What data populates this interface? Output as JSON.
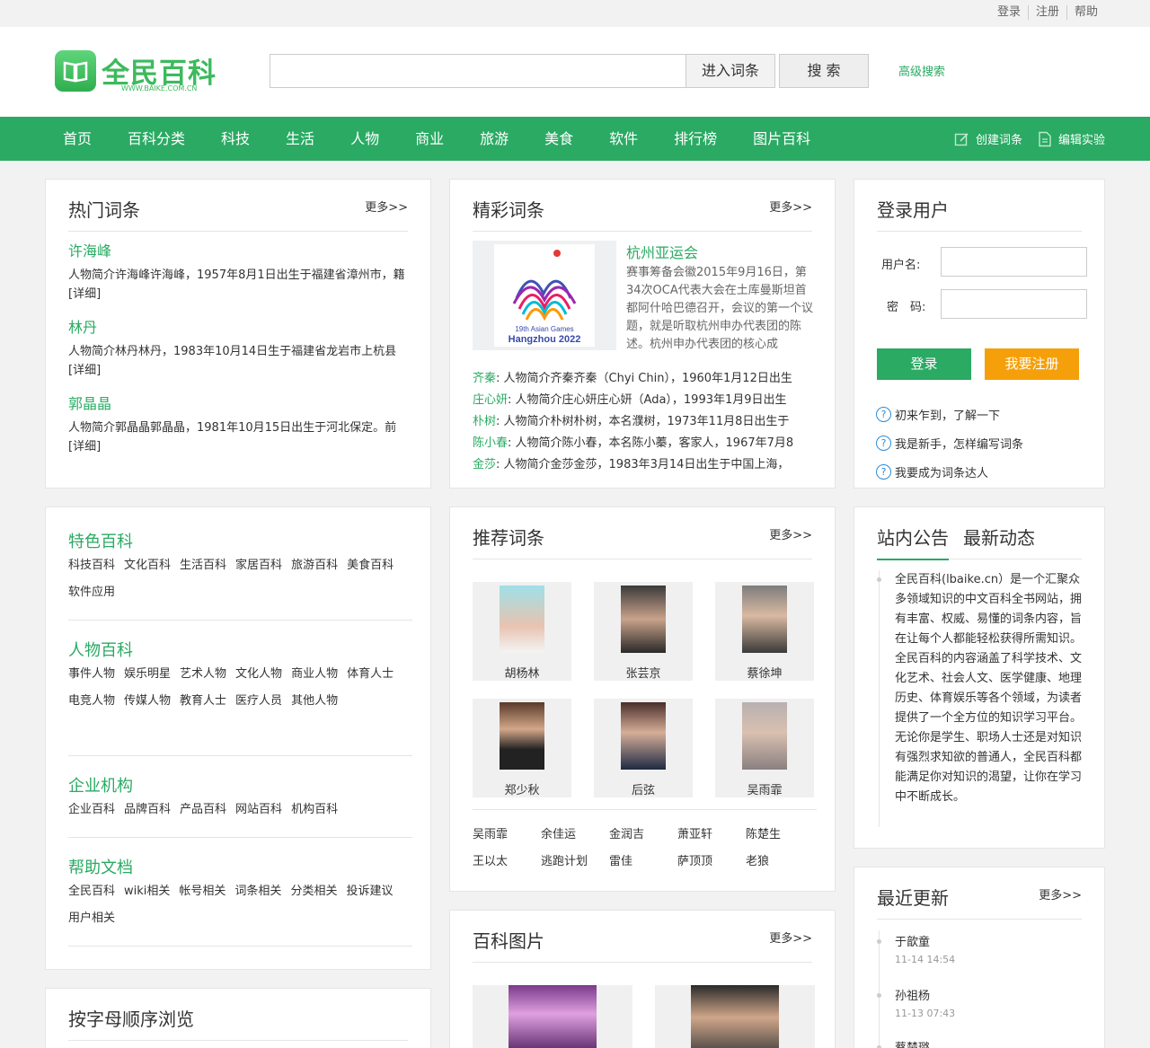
{
  "topbar": {
    "links": [
      "登录",
      "注册",
      "帮助"
    ]
  },
  "header": {
    "logo_text": "全民百科",
    "logo_sub": "WWW.BAIKE.COM.CN",
    "search_placeholder": "",
    "enter_button": "进入词条",
    "search_button": "搜 索",
    "advanced": "高级搜索"
  },
  "nav": {
    "items": [
      "首页",
      "百科分类",
      "科技",
      "生活",
      "人物",
      "商业",
      "旅游",
      "美食",
      "软件",
      "排行榜",
      "图片百科"
    ],
    "create": "创建词条",
    "edit": "编辑实验"
  },
  "hot": {
    "title": "热门词条",
    "more": "更多>>",
    "items": [
      {
        "name": "许海峰",
        "desc": "人物简介许海峰许海峰，1957年8月1日出生于福建省漳州市，籍[详细]"
      },
      {
        "name": "林丹",
        "desc": "人物简介林丹林丹，1983年10月14日生于福建省龙岩市上杭县[详细]"
      },
      {
        "name": "郭晶晶",
        "desc": "人物简介郭晶晶郭晶晶，1981年10月15日出生于河北保定。前[详细]"
      }
    ]
  },
  "featured": {
    "title": "精彩词条",
    "more": "更多>>",
    "main_title": "杭州亚运会",
    "main_desc": "赛事筹备会徽2015年9月16日，第34次OCA代表大会在土库曼斯坦首都阿什哈巴德召开，会议的第一个议题，就是听取杭州申办代表团的陈述。杭州申办代表团的核心成",
    "img_text1": "19th Asian Games",
    "img_text2": "Hangzhou 2022",
    "list": [
      {
        "name": "齐秦",
        "text": ": 人物简介齐秦齐秦（Chyi Chin），1960年1月12日出生"
      },
      {
        "name": "庄心妍",
        "text": ": 人物简介庄心妍庄心妍（Ada），1993年1月9日出生"
      },
      {
        "name": "朴树",
        "text": ": 人物简介朴树朴树，本名濮树，1973年11月8日出生于"
      },
      {
        "name": "陈小春",
        "text": ": 人物简介陈小春，本名陈小蓁，客家人，1967年7月8"
      },
      {
        "name": "金莎",
        "text": ": 人物简介金莎金莎，1983年3月14日出生于中国上海，"
      }
    ]
  },
  "login": {
    "title": "登录用户",
    "username_label": "用户名:",
    "password_label": "密　码:",
    "login_button": "登录",
    "register_button": "我要注册",
    "help": [
      "初来乍到，了解一下",
      "我是新手，怎样编写词条",
      "我要成为词条达人"
    ]
  },
  "categories": [
    {
      "title": "特色百科",
      "links": [
        "科技百科",
        "文化百科",
        "生活百科",
        "家居百科",
        "旅游百科",
        "美食百科",
        "软件应用"
      ]
    },
    {
      "title": "人物百科",
      "links": [
        "事件人物",
        "娱乐明星",
        "艺术人物",
        "文化人物",
        "商业人物",
        "体育人士",
        "电竞人物",
        "传媒人物",
        "教育人士",
        "医疗人员",
        "其他人物"
      ]
    },
    {
      "title": "企业机构",
      "links": [
        "企业百科",
        "品牌百科",
        "产品百科",
        "网站百科",
        "机构百科"
      ]
    },
    {
      "title": "帮助文档",
      "links": [
        "全民百科",
        "wiki相关",
        "帐号相关",
        "词条相关",
        "分类相关",
        "投诉建议",
        "用户相关"
      ]
    }
  ],
  "recommended": {
    "title": "推荐词条",
    "more": "更多>>",
    "people": [
      "胡杨林",
      "张芸京",
      "蔡徐坤",
      "郑少秋",
      "后弦",
      "吴雨霏"
    ],
    "words": [
      "吴雨霏",
      "余佳运",
      "金润吉",
      "萧亚轩",
      "陈楚生",
      "王以太",
      "逃跑计划",
      "雷佳",
      "萨顶顶",
      "老狼"
    ]
  },
  "notice": {
    "tab1": "站内公告",
    "tab2": "最新动态",
    "body": "全民百科(lbaike.cn）是一个汇聚众多领域知识的中文百科全书网站，拥有丰富、权威、易懂的词条内容，旨在让每个人都能轻松获得所需知识。全民百科的内容涵盖了科学技术、文化艺术、社会人文、医学健康、地理历史、体育娱乐等各个领域，为读者提供了一个全方位的知识学习平台。无论你是学生、职场人士还是对知识有强烈求知欲的普通人，全民百科都能满足你对知识的渴望，让你在学习中不断成长。"
  },
  "updates": {
    "title": "最近更新",
    "more": "更多>>",
    "items": [
      {
        "name": "于歆童",
        "time": "11-14 14:54"
      },
      {
        "name": "孙祖杨",
        "time": "11-13 07:43"
      },
      {
        "name": "蔡楚璐",
        "time": ""
      }
    ]
  },
  "pictures": {
    "title": "百科图片",
    "more": "更多>>"
  },
  "alpha": {
    "title": "按字母顺序浏览"
  },
  "colors": {
    "brand_green": "#2aaa63",
    "orange": "#f5a00a",
    "link_blue": "#2a8cd8"
  }
}
